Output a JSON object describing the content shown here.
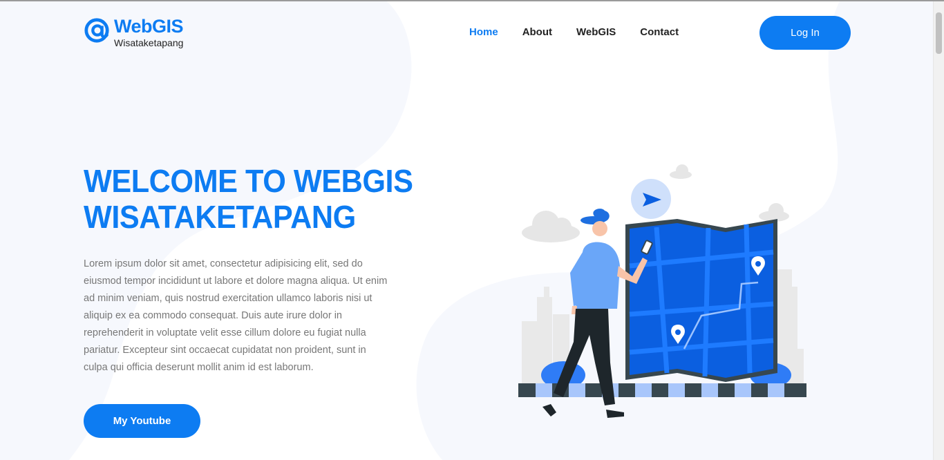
{
  "brand": {
    "name": "WebGIS",
    "subtitle": "Wisataketapang",
    "logo_icon": "at-sign-icon",
    "accent_color": "#0d7cf2"
  },
  "nav": {
    "items": [
      {
        "label": "Home",
        "active": true
      },
      {
        "label": "About",
        "active": false
      },
      {
        "label": "WebGIS",
        "active": false
      },
      {
        "label": "Contact",
        "active": false
      }
    ]
  },
  "header": {
    "login_label": "Log In"
  },
  "hero": {
    "title_line1": "WELCOME TO WEBGIS",
    "title_line2": "WISATAKETAPANG",
    "paragraph": "Lorem ipsum dolor sit amet, consectetur adipisicing elit, sed do eiusmod tempor incididunt ut labore et dolore magna aliqua. Ut enim ad minim veniam, quis nostrud exercitation ullamco laboris nisi ut aliquip ex ea commodo consequat. Duis aute irure dolor in reprehenderit in voluptate velit esse cillum dolore eu fugiat nulla pariatur. Excepteur sint occaecat cupidatat non proident, sunt in culpa qui officia deserunt mollit anim id est laborum.",
    "button_label": "My Youtube"
  }
}
